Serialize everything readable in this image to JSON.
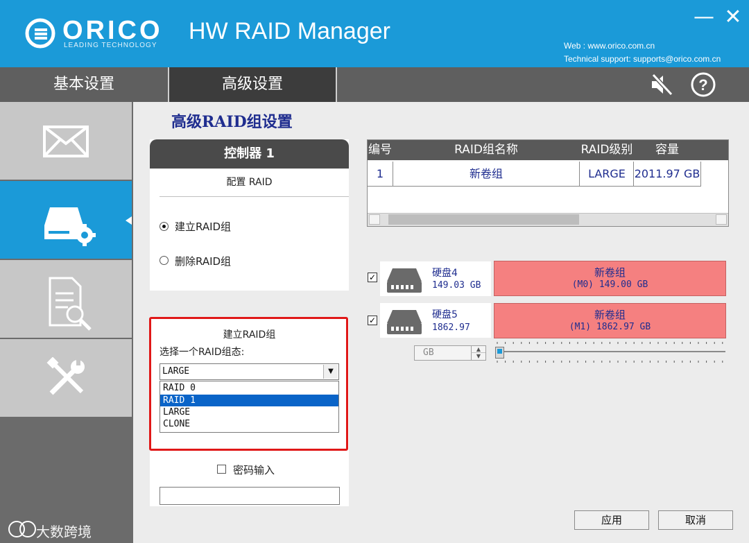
{
  "titlebar": {
    "brand": "ORICO",
    "tagline": "LEADING TECHNOLOGY",
    "app_title": "HW RAID Manager",
    "web": "Web : www.orico.com.cn",
    "support": "Technical support: supports@orico.com.cn",
    "minimize": "—",
    "close": "✕"
  },
  "tabs": [
    "基本设置",
    "高级设置"
  ],
  "active_tab": "高级设置",
  "sidebar": {
    "items": [
      {
        "icon": "mail-icon",
        "active": false
      },
      {
        "icon": "raid-disk-gear-icon",
        "active": true
      },
      {
        "icon": "log-search-icon",
        "active": false
      },
      {
        "icon": "tools-icon",
        "active": false
      }
    ]
  },
  "main": {
    "heading": "高级RAID组设置",
    "controller": {
      "title": "控制器 1",
      "config_label": "配置 RAID",
      "options": [
        {
          "label": "建立RAID组",
          "selected": true
        },
        {
          "label": "删除RAID组",
          "selected": false
        }
      ]
    },
    "create": {
      "title": "建立RAID组",
      "prompt": "选择一个RAID组态:",
      "selected_value": "LARGE",
      "dropdown_options": [
        "RAID 0",
        "RAID 1",
        "LARGE",
        "CLONE"
      ],
      "highlighted_option": "RAID 1",
      "password_label": "密码输入",
      "password_checked": false
    },
    "table": {
      "headers": [
        "编号",
        "RAID组名称",
        "RAID级别",
        "容量"
      ],
      "rows": [
        {
          "num": "1",
          "name": "新卷组",
          "level": "LARGE",
          "capacity": "2011.97 GB"
        }
      ]
    },
    "disks": [
      {
        "name": "硬盘4",
        "size": "149.03 GB",
        "checked": true,
        "volume_name": "新卷组",
        "volume_detail": "(M0) 149.00 GB"
      },
      {
        "name": "硬盘5",
        "size": "1862.97",
        "checked": true,
        "volume_name": "新卷组",
        "volume_detail": "(M1) 1862.97 GB"
      }
    ],
    "size_unit": "GB",
    "slider_level": 0,
    "buttons": {
      "apply": "应用",
      "cancel": "取消"
    }
  },
  "watermark": "大数跨境",
  "colors": {
    "brand_blue": "#1b9ad8",
    "volume_pink": "#f58080",
    "text_navy": "#1f2d8f",
    "highlight_red": "#e01818",
    "select_blue": "#0a64c8"
  }
}
